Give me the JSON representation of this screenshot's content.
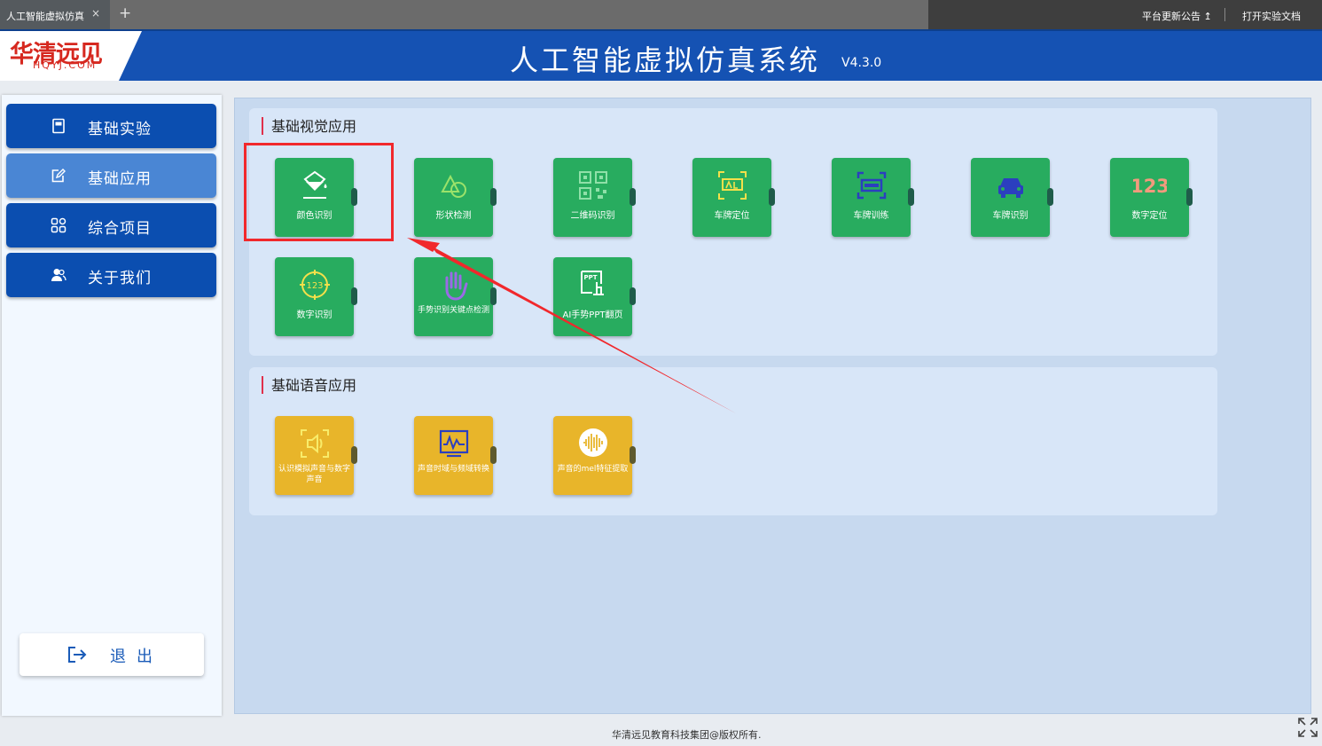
{
  "browser": {
    "tab_title": "人工智能虚拟仿真",
    "tab_close": "×",
    "new_tab": "+",
    "notice": "平台更新公告 ↥",
    "open_doc": "打开实验文档"
  },
  "header": {
    "logo_text": "华清远见",
    "logo_sub": "HQYJ.COM",
    "title": "人工智能虚拟仿真系统",
    "version": "V4.3.0"
  },
  "sidebar": {
    "items": [
      {
        "label": "基础实验",
        "icon": "notebook-icon",
        "active": false
      },
      {
        "label": "基础应用",
        "icon": "edit-icon",
        "active": true
      },
      {
        "label": "综合项目",
        "icon": "grid-icon",
        "active": false
      },
      {
        "label": "关于我们",
        "icon": "users-icon",
        "active": false
      }
    ],
    "exit_label": "退出"
  },
  "sections": [
    {
      "title": "基础视觉应用",
      "cards": [
        {
          "label": "颜色识别",
          "color": "#28ac5f",
          "icon": "paint-bucket-icon"
        },
        {
          "label": "形状检测",
          "color": "#28ac5f",
          "icon": "shapes-icon"
        },
        {
          "label": "二维码识别",
          "color": "#28ac5f",
          "icon": "qrcode-icon"
        },
        {
          "label": "车牌定位",
          "color": "#28ac5f",
          "icon": "plate-locate-icon"
        },
        {
          "label": "车牌训练",
          "color": "#28ac5f",
          "icon": "plate-scan-icon"
        },
        {
          "label": "车牌识别",
          "color": "#28ac5f",
          "icon": "car-icon"
        },
        {
          "label": "数字定位",
          "color": "#28ac5f",
          "icon": "digits-123-icon"
        },
        {
          "label": "数字识别",
          "color": "#28ac5f",
          "icon": "target-123-icon"
        },
        {
          "label": "手势识别关键点检测",
          "color": "#28ac5f",
          "icon": "hand-icon"
        },
        {
          "label": "AI手势PPT翻页",
          "color": "#28ac5f",
          "icon": "ppt-gesture-icon"
        }
      ]
    },
    {
      "title": "基础语音应用",
      "cards": [
        {
          "label": "认识模拟声音与数字声音",
          "color": "#e8b52a",
          "icon": "speaker-icon"
        },
        {
          "label": "声音时域与频域转换",
          "color": "#e8b52a",
          "icon": "waveform-icon"
        },
        {
          "label": "声音的mel特征提取",
          "color": "#e8b52a",
          "icon": "audio-wave-icon"
        }
      ]
    }
  ],
  "footer": "华清远见教育科技集团@版权所有.",
  "annotation_color": "#f1282c"
}
